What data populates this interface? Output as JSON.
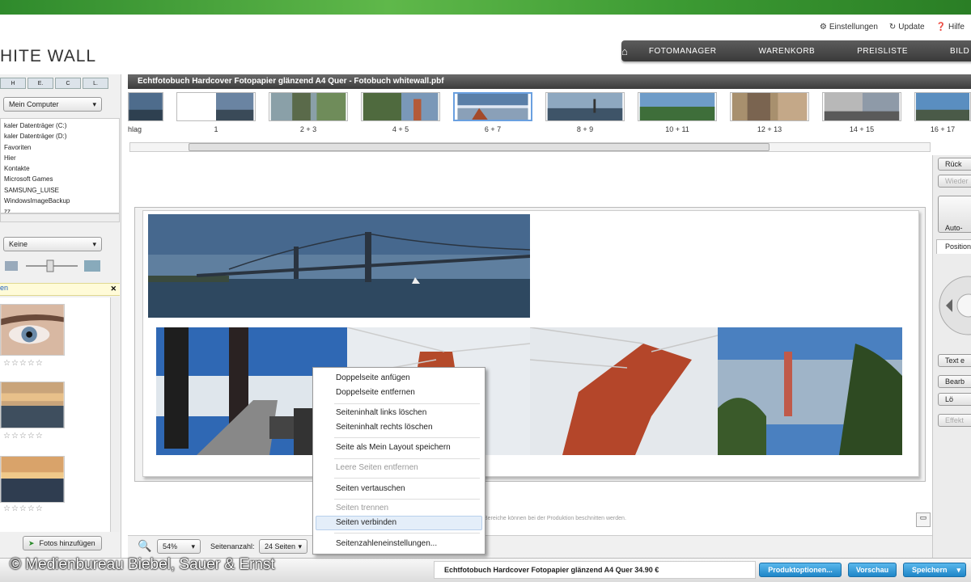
{
  "brand": {
    "logo": "HITE WALL"
  },
  "toplinks": {
    "settings": "Einstellungen",
    "update": "Update",
    "help": "Hilfe"
  },
  "nav": {
    "home_icon": "home-icon",
    "items": [
      "FOTOMANAGER",
      "WARENKORB",
      "PREISLISTE",
      "BILD"
    ]
  },
  "sidebar": {
    "tabs": [
      "H",
      "E.",
      "C",
      "L."
    ],
    "location": "Mein Computer",
    "tree": [
      "kaler Datenträger (C:)",
      "kaler Datenträger (D:)",
      "Favoriten",
      "Hier",
      "Kontakte",
      "Microsoft Games",
      "SAMSUNG_LUISE",
      "WindowsImageBackup",
      "zz"
    ],
    "filter": "Keine",
    "info_link": "en",
    "stars": "☆☆☆☆☆",
    "add_photos": "Fotos hinzufügen"
  },
  "document": {
    "title": "Echtfotobuch Hardcover Fotopapier glänzend A4 Quer - Fotobuch whitewall.pbf"
  },
  "filmstrip": {
    "labels": [
      "hlag",
      "1",
      "2 + 3",
      "4 + 5",
      "6 + 7",
      "8 + 9",
      "10 + 11",
      "12 + 13",
      "14 + 15",
      "16 + 17"
    ],
    "selected": "6 + 7"
  },
  "context_menu": {
    "items": [
      "Doppelseite anfügen",
      "Doppelseite entfernen",
      "Seiteninhalt links löschen",
      "Seiteninhalt rechts löschen",
      "Seite als Mein Layout speichern",
      "Leere Seiten entfernen",
      "Seiten vertauschen",
      "Seiten trennen",
      "Seiten verbinden",
      "Seitenzahleneinstellungen..."
    ],
    "disabled": [
      "Leere Seiten entfernen",
      "Seiten trennen"
    ],
    "highlighted": "Seiten verbinden"
  },
  "canvas": {
    "hint": "Bereiche können bei der Produktion beschnitten werden."
  },
  "bottombar": {
    "zoom": "54%",
    "pages_label": "Seitenanzahl:",
    "pages_value": "24 Seiten"
  },
  "right_panel": {
    "undo": "Rück",
    "redo": "Wieder",
    "auto": "Auto-",
    "tab_position": "Position",
    "text": "Text e",
    "edit": "Bearb",
    "delete": "Lö",
    "effects": "Effekt"
  },
  "footer": {
    "product": "Echtfotobuch Hardcover Fotopapier glänzend A4 Quer 34.90  €",
    "options": "Produktoptionen...",
    "preview": "Vorschau",
    "save": "Speichern"
  },
  "copyright": "© Medienbureau Biebel, Sauer & Ernst",
  "colors": {
    "accent_green": "#3c9a33",
    "button_blue": "#1f86c8",
    "nav_dark": "#3a3a3a"
  }
}
